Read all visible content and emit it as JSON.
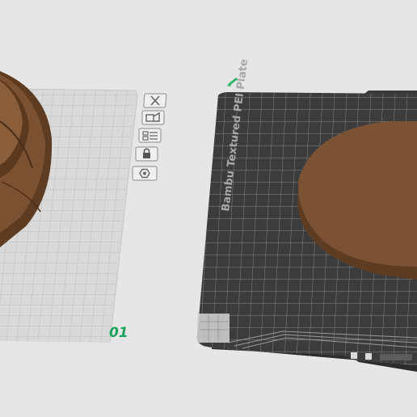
{
  "viewport": {
    "background": "#e6e6e6",
    "model_color": "#7a5232"
  },
  "plate_1": {
    "number_label": "01",
    "number_color": "#1aa35a",
    "toolbar": [
      {
        "icon": "close-icon",
        "label": "Delete plate"
      },
      {
        "icon": "orient-icon",
        "label": "Auto orient"
      },
      {
        "icon": "arrange-icon",
        "label": "Arrange"
      },
      {
        "icon": "lock-icon",
        "label": "Lock plate"
      },
      {
        "icon": "settings-icon",
        "label": "Plate settings"
      }
    ]
  },
  "plate_2": {
    "plate_name": "Bambu Textured PEI Plate",
    "edit_icon": "pencil-icon",
    "bed_color": "#3c3c3c"
  }
}
